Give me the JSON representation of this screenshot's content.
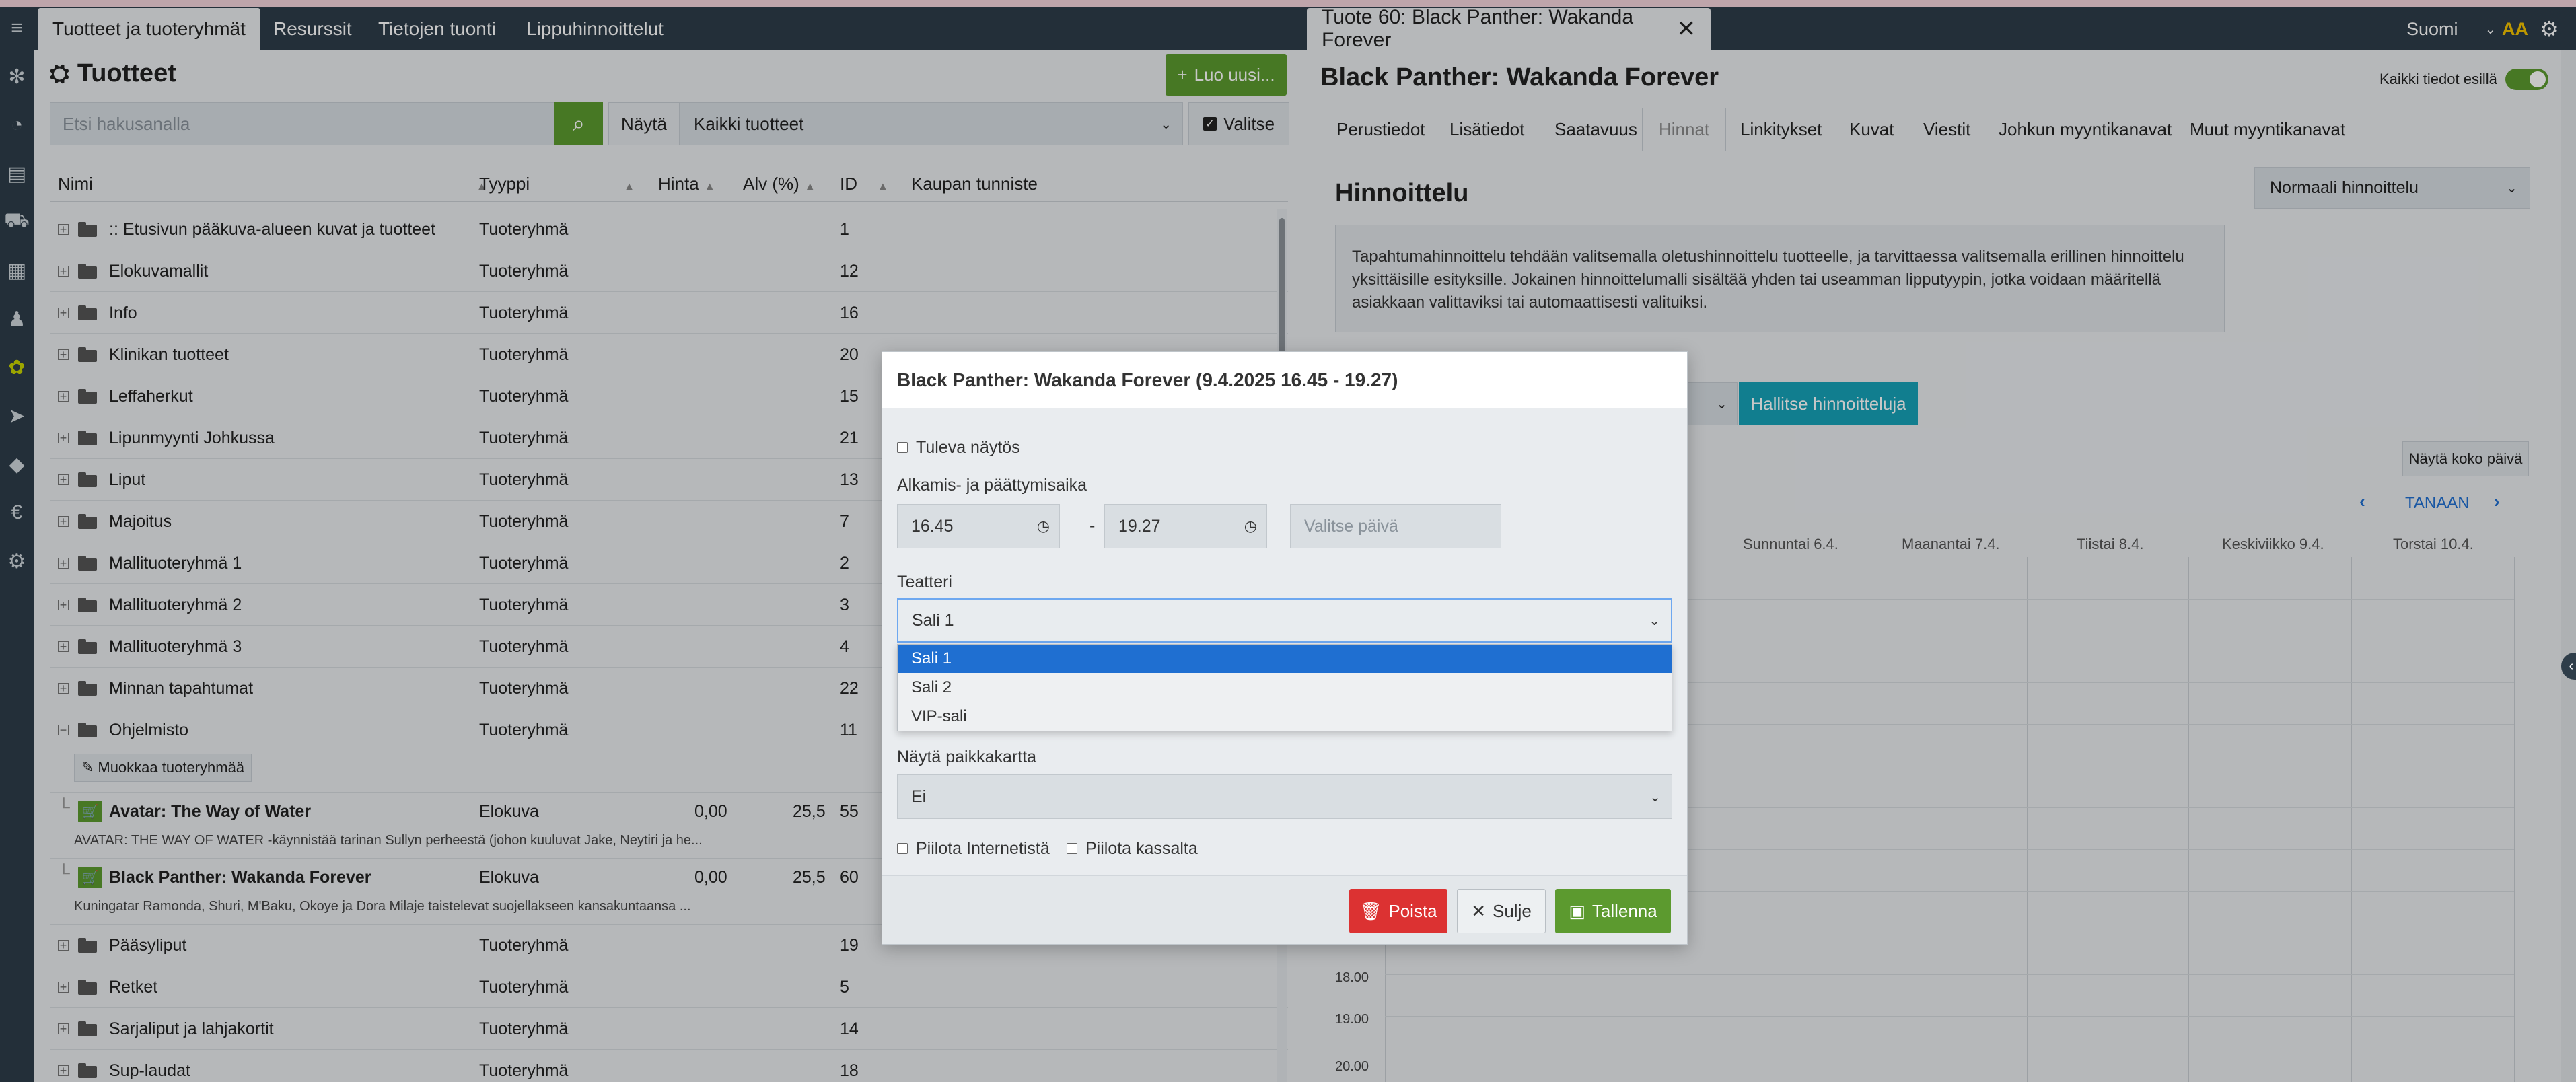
{
  "top_tabs_left": [
    {
      "label": "Tuotteet ja tuoteryhmät",
      "active": true
    },
    {
      "label": "Resurssit"
    },
    {
      "label": "Tietojen tuonti"
    },
    {
      "label": "Lippuhinnoittelut"
    }
  ],
  "right_tab": {
    "label": "Tuote 60: Black Panther: Wakanda Forever",
    "close": "✕"
  },
  "language": {
    "label": "Suomi"
  },
  "aa_label": "AA",
  "products": {
    "title": "Tuotteet",
    "create_button": "Luo uusi...",
    "search_placeholder": "Etsi hakusanalla",
    "show_label": "Näytä",
    "show_value": "Kaikki tuotteet",
    "select_button": "Valitse",
    "columns": [
      "Nimi",
      "Tyyppi",
      "Hinta",
      "Alv (%)",
      "ID",
      "Kaupan tunniste"
    ],
    "rows": [
      {
        "name": ":: Etusivun pääkuva-alueen kuvat ja tuotteet",
        "type": "Tuoteryhmä",
        "id": "1"
      },
      {
        "name": "Elokuvamallit",
        "type": "Tuoteryhmä",
        "id": "12"
      },
      {
        "name": "Info",
        "type": "Tuoteryhmä",
        "id": "16"
      },
      {
        "name": "Klinikan tuotteet",
        "type": "Tuoteryhmä",
        "id": "20"
      },
      {
        "name": "Leffaherkut",
        "type": "Tuoteryhmä",
        "id": "15"
      },
      {
        "name": "Lipunmyynti Johkussa",
        "type": "Tuoteryhmä",
        "id": "21"
      },
      {
        "name": "Liput",
        "type": "Tuoteryhmä",
        "id": "13"
      },
      {
        "name": "Majoitus",
        "type": "Tuoteryhmä",
        "id": "7"
      },
      {
        "name": "Mallituoteryhmä 1",
        "type": "Tuoteryhmä",
        "id": "2"
      },
      {
        "name": "Mallituoteryhmä 2",
        "type": "Tuoteryhmä",
        "id": "3"
      },
      {
        "name": "Mallituoteryhmä 3",
        "type": "Tuoteryhmä",
        "id": "4"
      },
      {
        "name": "Minnan tapahtumat",
        "type": "Tuoteryhmä",
        "id": "22"
      },
      {
        "name": "Ohjelmisto",
        "type": "Tuoteryhmä",
        "id": "11"
      }
    ],
    "edit_group_button": "Muokkaa tuoteryhmää",
    "product_rows": [
      {
        "name": "Avatar: The Way of Water",
        "type": "Elokuva",
        "price": "0,00",
        "vat": "25,5",
        "id": "55",
        "desc": "AVATAR: THE WAY OF WATER -käynnistää tarinan Sullyn perheestä (johon kuuluvat Jake, Neytiri ja he..."
      },
      {
        "name": "Black Panther: Wakanda Forever",
        "type": "Elokuva",
        "price": "0,00",
        "vat": "25,5",
        "id": "60",
        "desc": "Kuningatar Ramonda, Shuri, M'Baku, Okoye ja Dora Milaje taistelevat suojellakseen kansakuntaansa ..."
      }
    ],
    "rows_after": [
      {
        "name": "Pääsyliput",
        "type": "Tuoteryhmä",
        "id": "19"
      },
      {
        "name": "Retket",
        "type": "Tuoteryhmä",
        "id": "5"
      },
      {
        "name": "Sarjaliput ja lahjakortit",
        "type": "Tuoteryhmä",
        "id": "14"
      },
      {
        "name": "Sup-laudat",
        "type": "Tuoteryhmä",
        "id": "18"
      }
    ]
  },
  "product": {
    "title": "Black Panther: Wakanda Forever",
    "all_data_label": "Kaikki tiedot esillä",
    "tabs": [
      "Perustiedot",
      "Lisätiedot",
      "Saatavuus",
      "Hinnat",
      "Linkitykset",
      "Kuvat",
      "Viestit",
      "Johkun myyntikanavat",
      "Muut myyntikanavat"
    ],
    "active_tab": "Hinnat",
    "pricing_title": "Hinnoittelu",
    "pricing_select": "Normaali hinnoittelu",
    "info_text": "Tapahtumahinnoittelu tehdään valitsemalla oletushinnoittelu tuotteelle, ja tarvittaessa valitsemalla erillinen hinnoittelu yksittäisille esityksille. Jokainen hinnoittelumalli sisältää yhden tai useamman lipputyypin, jotka voidaan määritellä asiakkaan valittaviksi tai automaattisesti valituiksi.",
    "manage_button": "Hallitse hinnoitteluja",
    "full_day_button": "Näytä koko päivä",
    "today_label": "TANAAN",
    "days": [
      "Sunnuntai 6.4.",
      "Maanantai 7.4.",
      "Tiistai 8.4.",
      "Keskiviikko 9.4.",
      "Torstai 10.4."
    ],
    "times": [
      "18.00",
      "19.00",
      "20.00"
    ]
  },
  "modal": {
    "title": "Black Panther: Wakanda Forever (9.4.2025 16.45 - 19.27)",
    "upcoming_label": "Tuleva näytös",
    "time_label": "Alkamis- ja päättymisaika",
    "start": "16.45",
    "dash": "-",
    "end": "19.27",
    "date_placeholder": "Valitse päivä",
    "theater_label": "Teatteri",
    "theater_value": "Sali 1",
    "theater_options": [
      "Sali 1",
      "Sali 2",
      "VIP-sali"
    ],
    "seatmap_label": "Näytä paikkakartta",
    "seatmap_value": "Ei",
    "hide_internet": "Piilota Internetistä",
    "hide_pos": "Piilota kassalta",
    "delete_button": "Poista",
    "close_button": "Sulje",
    "save_button": "Tallenna"
  }
}
